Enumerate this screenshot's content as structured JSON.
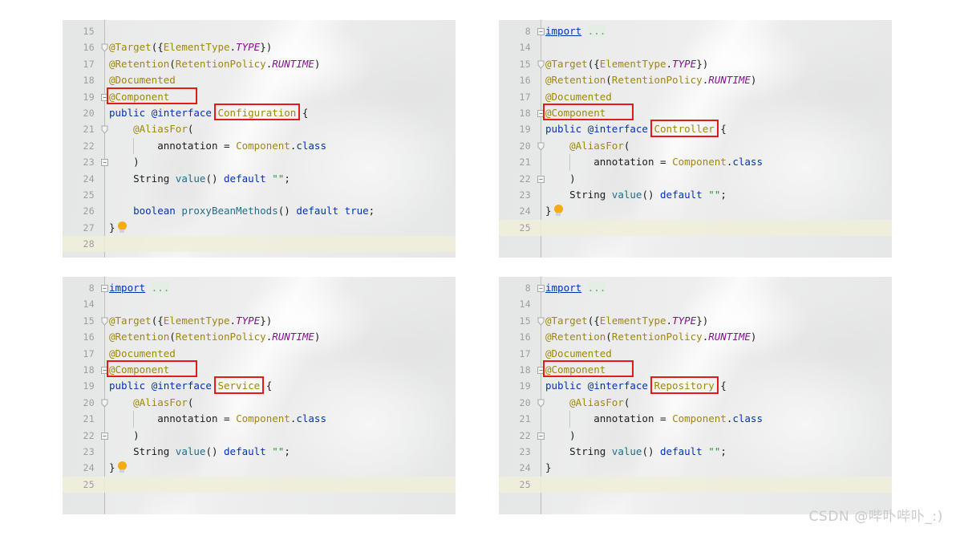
{
  "watermark": {
    "text": "CSDN @哔卟哔卟_:)"
  },
  "panels": [
    {
      "id": "configuration-panel",
      "annotation_name": "Configuration",
      "highlight_color": "#e41b17",
      "lines": [
        {
          "num": "15",
          "text": "",
          "fold": "none"
        },
        {
          "num": "16",
          "text": "@Target({ElementType.TYPE})",
          "fold": "open"
        },
        {
          "num": "17",
          "text": "@Retention(RetentionPolicy.RUNTIME)",
          "fold": "none"
        },
        {
          "num": "18",
          "text": "@Documented",
          "fold": "none"
        },
        {
          "num": "19",
          "text": "@Component",
          "fold": "collapse"
        },
        {
          "num": "20",
          "text": "public @interface Configuration {",
          "fold": "none"
        },
        {
          "num": "21",
          "text": "    @AliasFor(",
          "fold": "open"
        },
        {
          "num": "22",
          "text": "        annotation = Component.class",
          "fold": "none"
        },
        {
          "num": "23",
          "text": "    )",
          "fold": "collapse"
        },
        {
          "num": "24",
          "text": "    String value() default \"\";",
          "fold": "none"
        },
        {
          "num": "25",
          "text": "",
          "fold": "none"
        },
        {
          "num": "26",
          "text": "    boolean proxyBeanMethods() default true;",
          "fold": "none"
        },
        {
          "num": "27",
          "text": "}",
          "fold": "none"
        },
        {
          "num": "28",
          "text": "",
          "fold": "none"
        }
      ]
    },
    {
      "id": "controller-panel",
      "annotation_name": "Controller",
      "highlight_color": "#e41b17",
      "lines": [
        {
          "num": "8",
          "text": "import ...",
          "fold": "collapse"
        },
        {
          "num": "14",
          "text": "",
          "fold": "none"
        },
        {
          "num": "15",
          "text": "@Target({ElementType.TYPE})",
          "fold": "open"
        },
        {
          "num": "16",
          "text": "@Retention(RetentionPolicy.RUNTIME)",
          "fold": "none"
        },
        {
          "num": "17",
          "text": "@Documented",
          "fold": "none"
        },
        {
          "num": "18",
          "text": "@Component",
          "fold": "collapse"
        },
        {
          "num": "19",
          "text": "public @interface Controller {",
          "fold": "none"
        },
        {
          "num": "20",
          "text": "    @AliasFor(",
          "fold": "open"
        },
        {
          "num": "21",
          "text": "        annotation = Component.class",
          "fold": "none"
        },
        {
          "num": "22",
          "text": "    )",
          "fold": "collapse"
        },
        {
          "num": "23",
          "text": "    String value() default \"\";",
          "fold": "none"
        },
        {
          "num": "24",
          "text": "}",
          "fold": "none"
        },
        {
          "num": "25",
          "text": "",
          "fold": "none"
        }
      ]
    },
    {
      "id": "service-panel",
      "annotation_name": "Service",
      "highlight_color": "#e41b17",
      "lines": [
        {
          "num": "8",
          "text": "import ...",
          "fold": "collapse"
        },
        {
          "num": "14",
          "text": "",
          "fold": "none"
        },
        {
          "num": "15",
          "text": "@Target({ElementType.TYPE})",
          "fold": "open"
        },
        {
          "num": "16",
          "text": "@Retention(RetentionPolicy.RUNTIME)",
          "fold": "none"
        },
        {
          "num": "17",
          "text": "@Documented",
          "fold": "none"
        },
        {
          "num": "18",
          "text": "@Component",
          "fold": "collapse"
        },
        {
          "num": "19",
          "text": "public @interface Service {",
          "fold": "none"
        },
        {
          "num": "20",
          "text": "    @AliasFor(",
          "fold": "open"
        },
        {
          "num": "21",
          "text": "        annotation = Component.class",
          "fold": "none"
        },
        {
          "num": "22",
          "text": "    )",
          "fold": "collapse"
        },
        {
          "num": "23",
          "text": "    String value() default \"\";",
          "fold": "none"
        },
        {
          "num": "24",
          "text": "}",
          "fold": "none"
        },
        {
          "num": "25",
          "text": "",
          "fold": "none"
        }
      ]
    },
    {
      "id": "repository-panel",
      "annotation_name": "Repository",
      "highlight_color": "#e41b17",
      "lines": [
        {
          "num": "8",
          "text": "import ...",
          "fold": "collapse"
        },
        {
          "num": "14",
          "text": "",
          "fold": "none"
        },
        {
          "num": "15",
          "text": "@Target({ElementType.TYPE})",
          "fold": "open"
        },
        {
          "num": "16",
          "text": "@Retention(RetentionPolicy.RUNTIME)",
          "fold": "none"
        },
        {
          "num": "17",
          "text": "@Documented",
          "fold": "none"
        },
        {
          "num": "18",
          "text": "@Component",
          "fold": "collapse"
        },
        {
          "num": "19",
          "text": "public @interface Repository {",
          "fold": "none"
        },
        {
          "num": "20",
          "text": "    @AliasFor(",
          "fold": "open"
        },
        {
          "num": "21",
          "text": "        annotation = Component.class",
          "fold": "none"
        },
        {
          "num": "22",
          "text": "    )",
          "fold": "collapse"
        },
        {
          "num": "23",
          "text": "    String value() default \"\";",
          "fold": "none"
        },
        {
          "num": "24",
          "text": "}",
          "fold": "none"
        },
        {
          "num": "25",
          "text": "",
          "fold": "none"
        }
      ]
    }
  ]
}
